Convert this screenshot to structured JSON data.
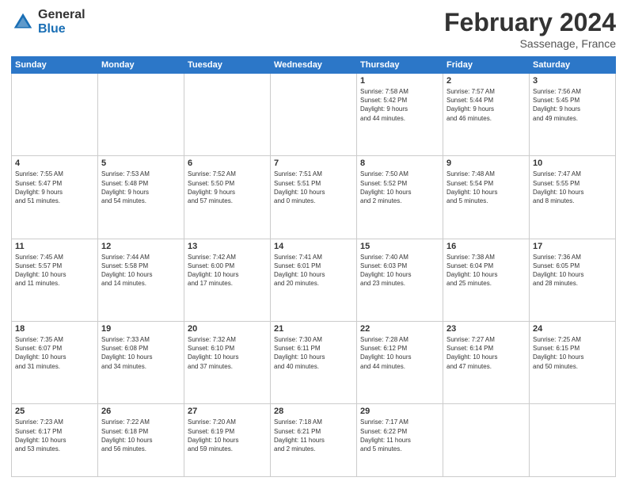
{
  "header": {
    "logo_general": "General",
    "logo_blue": "Blue",
    "title": "February 2024",
    "location": "Sassenage, France"
  },
  "days_of_week": [
    "Sunday",
    "Monday",
    "Tuesday",
    "Wednesday",
    "Thursday",
    "Friday",
    "Saturday"
  ],
  "weeks": [
    [
      {
        "day": "",
        "info": ""
      },
      {
        "day": "",
        "info": ""
      },
      {
        "day": "",
        "info": ""
      },
      {
        "day": "",
        "info": ""
      },
      {
        "day": "1",
        "info": "Sunrise: 7:58 AM\nSunset: 5:42 PM\nDaylight: 9 hours\nand 44 minutes."
      },
      {
        "day": "2",
        "info": "Sunrise: 7:57 AM\nSunset: 5:44 PM\nDaylight: 9 hours\nand 46 minutes."
      },
      {
        "day": "3",
        "info": "Sunrise: 7:56 AM\nSunset: 5:45 PM\nDaylight: 9 hours\nand 49 minutes."
      }
    ],
    [
      {
        "day": "4",
        "info": "Sunrise: 7:55 AM\nSunset: 5:47 PM\nDaylight: 9 hours\nand 51 minutes."
      },
      {
        "day": "5",
        "info": "Sunrise: 7:53 AM\nSunset: 5:48 PM\nDaylight: 9 hours\nand 54 minutes."
      },
      {
        "day": "6",
        "info": "Sunrise: 7:52 AM\nSunset: 5:50 PM\nDaylight: 9 hours\nand 57 minutes."
      },
      {
        "day": "7",
        "info": "Sunrise: 7:51 AM\nSunset: 5:51 PM\nDaylight: 10 hours\nand 0 minutes."
      },
      {
        "day": "8",
        "info": "Sunrise: 7:50 AM\nSunset: 5:52 PM\nDaylight: 10 hours\nand 2 minutes."
      },
      {
        "day": "9",
        "info": "Sunrise: 7:48 AM\nSunset: 5:54 PM\nDaylight: 10 hours\nand 5 minutes."
      },
      {
        "day": "10",
        "info": "Sunrise: 7:47 AM\nSunset: 5:55 PM\nDaylight: 10 hours\nand 8 minutes."
      }
    ],
    [
      {
        "day": "11",
        "info": "Sunrise: 7:45 AM\nSunset: 5:57 PM\nDaylight: 10 hours\nand 11 minutes."
      },
      {
        "day": "12",
        "info": "Sunrise: 7:44 AM\nSunset: 5:58 PM\nDaylight: 10 hours\nand 14 minutes."
      },
      {
        "day": "13",
        "info": "Sunrise: 7:42 AM\nSunset: 6:00 PM\nDaylight: 10 hours\nand 17 minutes."
      },
      {
        "day": "14",
        "info": "Sunrise: 7:41 AM\nSunset: 6:01 PM\nDaylight: 10 hours\nand 20 minutes."
      },
      {
        "day": "15",
        "info": "Sunrise: 7:40 AM\nSunset: 6:03 PM\nDaylight: 10 hours\nand 23 minutes."
      },
      {
        "day": "16",
        "info": "Sunrise: 7:38 AM\nSunset: 6:04 PM\nDaylight: 10 hours\nand 25 minutes."
      },
      {
        "day": "17",
        "info": "Sunrise: 7:36 AM\nSunset: 6:05 PM\nDaylight: 10 hours\nand 28 minutes."
      }
    ],
    [
      {
        "day": "18",
        "info": "Sunrise: 7:35 AM\nSunset: 6:07 PM\nDaylight: 10 hours\nand 31 minutes."
      },
      {
        "day": "19",
        "info": "Sunrise: 7:33 AM\nSunset: 6:08 PM\nDaylight: 10 hours\nand 34 minutes."
      },
      {
        "day": "20",
        "info": "Sunrise: 7:32 AM\nSunset: 6:10 PM\nDaylight: 10 hours\nand 37 minutes."
      },
      {
        "day": "21",
        "info": "Sunrise: 7:30 AM\nSunset: 6:11 PM\nDaylight: 10 hours\nand 40 minutes."
      },
      {
        "day": "22",
        "info": "Sunrise: 7:28 AM\nSunset: 6:12 PM\nDaylight: 10 hours\nand 44 minutes."
      },
      {
        "day": "23",
        "info": "Sunrise: 7:27 AM\nSunset: 6:14 PM\nDaylight: 10 hours\nand 47 minutes."
      },
      {
        "day": "24",
        "info": "Sunrise: 7:25 AM\nSunset: 6:15 PM\nDaylight: 10 hours\nand 50 minutes."
      }
    ],
    [
      {
        "day": "25",
        "info": "Sunrise: 7:23 AM\nSunset: 6:17 PM\nDaylight: 10 hours\nand 53 minutes."
      },
      {
        "day": "26",
        "info": "Sunrise: 7:22 AM\nSunset: 6:18 PM\nDaylight: 10 hours\nand 56 minutes."
      },
      {
        "day": "27",
        "info": "Sunrise: 7:20 AM\nSunset: 6:19 PM\nDaylight: 10 hours\nand 59 minutes."
      },
      {
        "day": "28",
        "info": "Sunrise: 7:18 AM\nSunset: 6:21 PM\nDaylight: 11 hours\nand 2 minutes."
      },
      {
        "day": "29",
        "info": "Sunrise: 7:17 AM\nSunset: 6:22 PM\nDaylight: 11 hours\nand 5 minutes."
      },
      {
        "day": "",
        "info": ""
      },
      {
        "day": "",
        "info": ""
      }
    ]
  ]
}
